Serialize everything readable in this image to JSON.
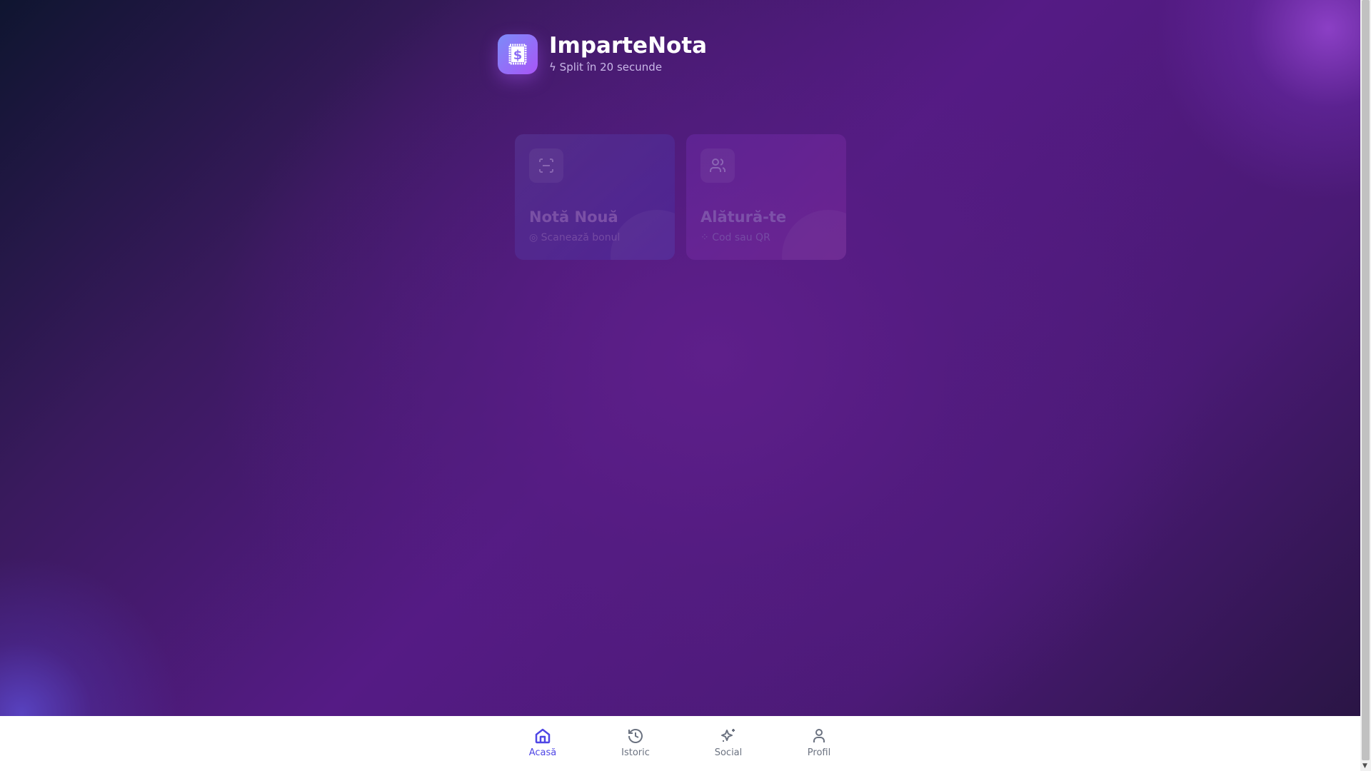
{
  "app": {
    "title": "ImparteNota",
    "subtitle": "Split în 20 secunde"
  },
  "cards": [
    {
      "title": "Notă Nouă",
      "subtitle": "Scanează bonul",
      "icon": "scan-icon"
    },
    {
      "title": "Alătură-te",
      "subtitle": "Cod sau QR",
      "icon": "users-icon"
    }
  ],
  "nav": [
    {
      "label": "Acasă",
      "icon": "home-icon",
      "active": true
    },
    {
      "label": "Istoric",
      "icon": "history-icon"
    },
    {
      "label": "Social",
      "icon": "sparkles-icon"
    },
    {
      "label": "Profil",
      "icon": "user-icon"
    }
  ],
  "colors": {
    "accent": "#4f46e5",
    "logo": "#a855f7"
  }
}
